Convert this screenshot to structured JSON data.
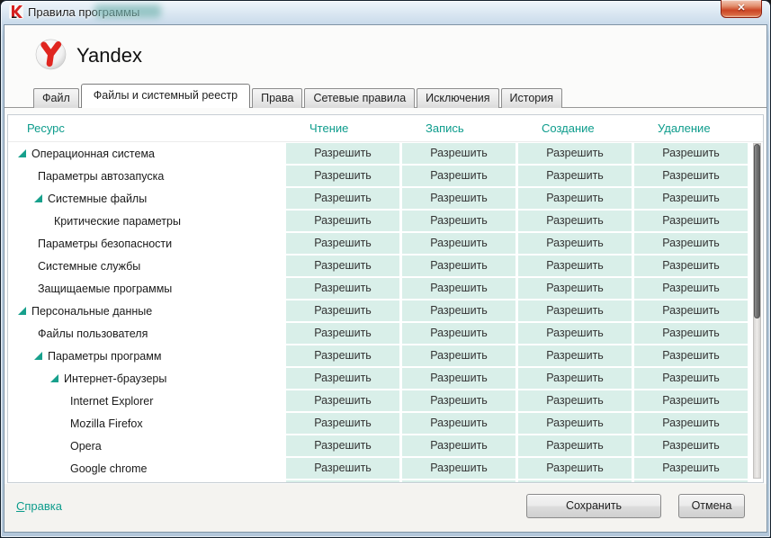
{
  "titlebar": {
    "title": "Правила программы"
  },
  "icons": {
    "close": "✕",
    "app_icon": "kaspersky-k",
    "logo": "yandex-sphere",
    "tree_expanded": "triangle-se"
  },
  "app": {
    "name": "Yandex"
  },
  "tabs": [
    {
      "label": "Файл",
      "active": false
    },
    {
      "label": "Файлы и системный реестр",
      "active": true
    },
    {
      "label": "Права",
      "active": false
    },
    {
      "label": "Сетевые правила",
      "active": false
    },
    {
      "label": "Исключения",
      "active": false
    },
    {
      "label": "История",
      "active": false
    }
  ],
  "table": {
    "resource_header": "Ресурс",
    "action_headers": [
      "Чтение",
      "Запись",
      "Создание",
      "Удаление"
    ],
    "cell_label": "Разрешить",
    "rows": [
      {
        "label": "Операционная система",
        "level": 0,
        "expandable": true
      },
      {
        "label": "Параметры автозапуска",
        "level": 1,
        "expandable": false
      },
      {
        "label": "Системные файлы",
        "level": 1,
        "expandable": true
      },
      {
        "label": "Критические параметры",
        "level": 2,
        "expandable": false
      },
      {
        "label": "Параметры безопасности",
        "level": 1,
        "expandable": false
      },
      {
        "label": "Системные службы",
        "level": 1,
        "expandable": false
      },
      {
        "label": "Защищаемые программы",
        "level": 1,
        "expandable": false
      },
      {
        "label": "Персональные данные",
        "level": 0,
        "expandable": true
      },
      {
        "label": "Файлы пользователя",
        "level": 1,
        "expandable": false
      },
      {
        "label": "Параметры программ",
        "level": 1,
        "expandable": true
      },
      {
        "label": "Интернет-браузеры",
        "level": 2,
        "expandable": true
      },
      {
        "label": "Internet Explorer",
        "level": 3,
        "expandable": false
      },
      {
        "label": "Mozilla Firefox",
        "level": 3,
        "expandable": false
      },
      {
        "label": "Opera",
        "level": 3,
        "expandable": false
      },
      {
        "label": "Google chrome",
        "level": 3,
        "expandable": false
      }
    ]
  },
  "footer": {
    "help": "Справка",
    "save": "Сохранить",
    "cancel": "Отмена"
  },
  "colors": {
    "accent_teal": "#0d9c8c",
    "cell_bg": "#d9efe9",
    "close_red": "#cb4524"
  }
}
